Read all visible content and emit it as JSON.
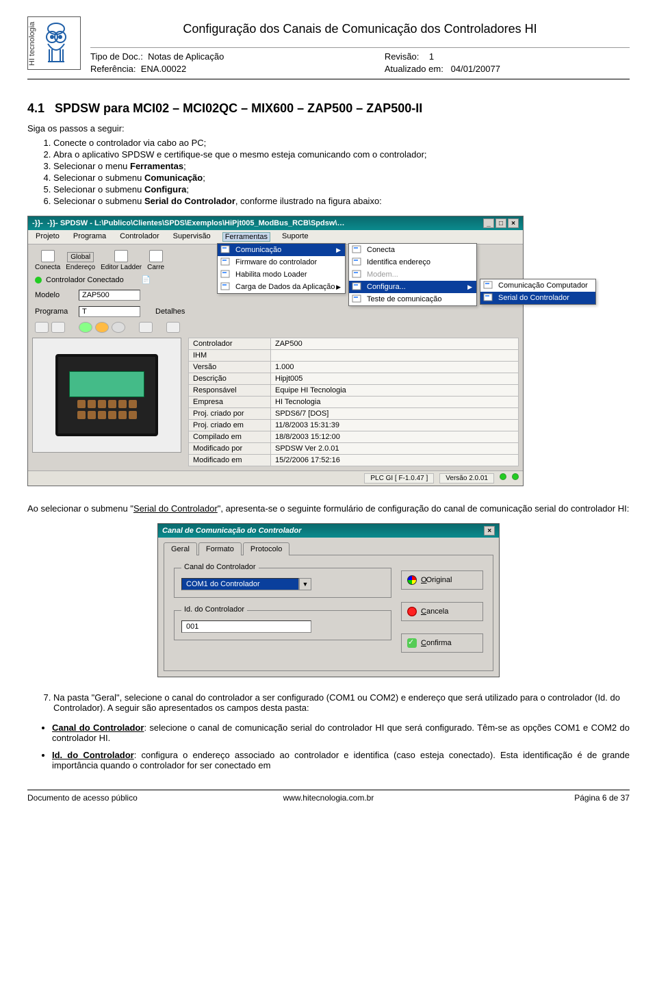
{
  "header": {
    "title": "Configuração dos Canais de Comunicação dos Controladores HI",
    "doc_type_label": "Tipo de Doc.:",
    "doc_type": "Notas de Aplicação",
    "ref_label": "Referência:",
    "ref": "ENA.00022",
    "rev_label": "Revisão:",
    "rev": "1",
    "updated_label": "Atualizado em:",
    "updated": "04/01/20077"
  },
  "section": {
    "num": "4.1",
    "title": "SPDSW para MCI02 – MCI02QC – MIX600 – ZAP500 – ZAP500-II",
    "intro": "Siga os passos a seguir:",
    "step1": "Conecte o controlador via cabo ao PC;",
    "step2": "Abra o aplicativo SPDSW e certifique-se que o mesmo esteja comunicando com o controlador;",
    "step3a": "Selecionar o menu ",
    "step3b": "Ferramentas",
    "step3c": ";",
    "step4a": "Selecionar o submenu ",
    "step4b": "Comunicação",
    "step4c": ";",
    "step5a": "Selecionar o submenu ",
    "step5b": "Configura",
    "step5c": ";",
    "step6a": "Selecionar o submenu ",
    "step6b": "Serial do Controlador",
    "step6c": ", conforme ilustrado na figura abaixo:"
  },
  "shot1": {
    "title": "-}}- SPDSW - L:\\Publico\\Clientes\\SPDS\\Exemplos\\HiPjt005_ModBus_RCB\\Spdsw\\…",
    "menus": [
      "Projeto",
      "Programa",
      "Controlador",
      "Supervisão",
      "Ferramentas",
      "Suporte"
    ],
    "toolbar": {
      "conecta": "Conecta",
      "global": "Global",
      "endereco": "Endereço",
      "editor": "Editor Ladder",
      "carre": "Carre"
    },
    "status_conn": "Controlador Conectado",
    "modelo_label": "Modelo",
    "modelo": "ZAP500",
    "programa_label": "Programa",
    "programa": "T",
    "detalhes": "Detalhes",
    "props": [
      [
        "Controlador",
        "ZAP500"
      ],
      [
        "IHM",
        ""
      ],
      [
        "Versão",
        "1.000"
      ],
      [
        "Descrição",
        "Hipjt005"
      ],
      [
        "Responsável",
        "Equipe HI Tecnologia"
      ],
      [
        "Empresa",
        "HI Tecnologia"
      ],
      [
        "Proj. criado por",
        "SPDS6/7 [DOS]"
      ],
      [
        "Proj. criado em",
        "11/8/2003 15:31:39"
      ],
      [
        "Compilado em",
        "18/8/2003 15:12:00"
      ],
      [
        "Modificado por",
        "SPDSW Ver 2.0.01"
      ],
      [
        "Modificado em",
        "15/2/2006 17:52:16"
      ]
    ],
    "status1": "PLC GI [ F-1.0.47 ]",
    "status2": "Versão 2.0.01",
    "popup1": {
      "items": [
        {
          "label": "Comunicação",
          "hl": true,
          "arrow": true
        },
        {
          "label": "Firmware do controlador"
        },
        {
          "label": "Habilita modo Loader"
        },
        {
          "label": "Carga de Dados da Aplicação",
          "arrow": true
        }
      ]
    },
    "popup2": {
      "items": [
        {
          "label": "Conecta"
        },
        {
          "label": "Identifica endereço"
        },
        {
          "label": "Modem...",
          "grey": true
        },
        {
          "label": "Configura...",
          "hl": true,
          "arrow": true
        },
        {
          "label": "Teste de comunicação"
        }
      ]
    },
    "popup3": {
      "items": [
        {
          "label": "Comunicação Computador"
        },
        {
          "label": "Serial do Controlador",
          "hl": true
        }
      ]
    }
  },
  "mid_para_a": "Ao selecionar o submenu \"",
  "mid_para_b": "Serial do Controlador",
  "mid_para_c": "\", apresenta-se o seguinte formulário de configuração do canal de comunicação serial do controlador HI:",
  "shot2": {
    "title": "Canal de Comunicação do Controlador",
    "tabs": [
      "Geral",
      "Formato",
      "Protocolo"
    ],
    "grp1": "Canal do Controlador",
    "combo": "COM1 do Controlador",
    "grp2": "Id. do Controlador",
    "id": "001",
    "btn_orig_label": "Original",
    "btn_orig_u": "O",
    "btn_cancel_label": "ancela",
    "btn_cancel_u": "C",
    "btn_ok_label": "onfirma",
    "btn_ok_u": "C"
  },
  "step7_a": "Na pasta \"Geral\", selecione o canal do controlador a ser configurado (COM1 ou COM2) e endereço que será utilizado para o controlador (Id. do Controlador). A seguir são apresentados os campos desta pasta:",
  "bullet1_t": "Canal do Controlador",
  "bullet1_b": ": selecione o canal de comunicação serial do controlador HI que será configurado. Têm-se as opções COM1 e COM2 do controlador HI.",
  "bullet2_t": "Id. do Controlador",
  "bullet2_b": ": configura o endereço associado ao controlador e identifica (caso esteja conectado). Esta identificação é de grande importância quando o controlador for ser conectado em",
  "footer": {
    "left": "Documento de acesso público",
    "center": "www.hitecnologia.com.br",
    "right": "Página 6 de 37"
  }
}
